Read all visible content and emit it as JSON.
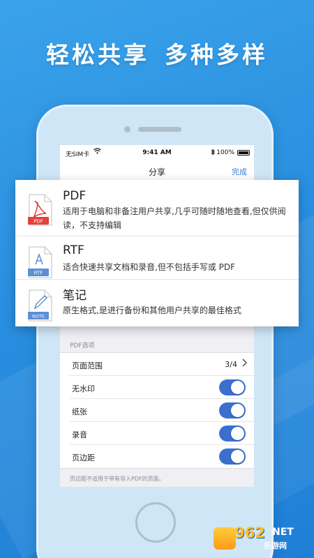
{
  "headline": {
    "part1": "轻松共享",
    "part2": "多种多样"
  },
  "status_bar": {
    "carrier": "无SIM卡",
    "time": "9:41 AM",
    "battery": "100%"
  },
  "nav": {
    "title": "分享",
    "done_label": "完成"
  },
  "share_formats": [
    {
      "icon_label": "PDF",
      "name": "PDF",
      "description": "适用于电脑和非备注用户共享,几乎可随时随地查看,但仅供阅读，不支持编辑"
    },
    {
      "icon_label": "RTF",
      "name": "RTF",
      "description": "适合快速共享文档和录音,但不包括手写或 PDF"
    },
    {
      "icon_label": "NOTE",
      "name": "笔记",
      "description": "原生格式,是进行备份和其他用户共享的最佳格式"
    }
  ],
  "pdf_options": {
    "section_label": "PDF选项",
    "page_range": {
      "label": "页面范围",
      "value": "3/4"
    },
    "toggles": [
      {
        "label": "无水印",
        "on": true
      },
      {
        "label": "纸张",
        "on": true
      },
      {
        "label": "录音",
        "on": true
      },
      {
        "label": "页边距",
        "on": true
      }
    ],
    "footnote": "页边距不适用于带有导入PDF的页面。"
  },
  "watermark": {
    "number": "962",
    "net": "NET",
    "site": "乐游网"
  },
  "colors": {
    "background": "#2a8fe0",
    "toggle_on": "#3a6fcf",
    "pdf_icon": "#e0423a",
    "doc_icon": "#5b8fd6",
    "link": "#2f7fd8"
  }
}
